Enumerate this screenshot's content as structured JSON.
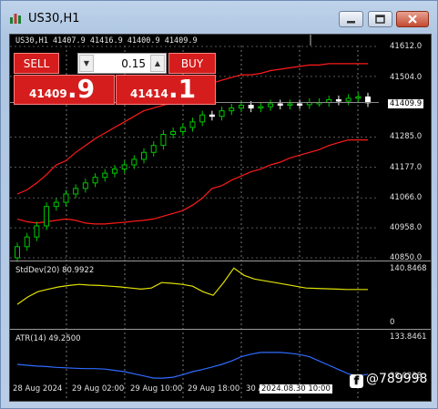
{
  "window": {
    "title": "US30,H1",
    "icon": "chart-bars-icon",
    "controls": [
      "minimize-icon",
      "restore-icon",
      "close-icon"
    ]
  },
  "chart": {
    "header": "US30,H1  41407.9 41416.9 41400.9 41409.9",
    "current_price": "41409.9",
    "price_axis": [
      "41612.0",
      "41504.0",
      "41285.0",
      "41177.0",
      "41066.0",
      "40958.0",
      "40850.0"
    ],
    "time_axis": [
      "28 Aug 2024",
      "29 Aug 02:00",
      "29 Aug 10:00",
      "29 Aug 18:00",
      "30 Au"
    ],
    "crosshair_time": "2024.08.30 10:00",
    "stddev": {
      "label": "StdDev(20) 80.9922",
      "max": "140.8468",
      "min": "0"
    },
    "atr": {
      "label": "ATR(14) 49.2500",
      "max": "133.8461",
      "min": "38.0238"
    },
    "colors": {
      "bull": "#00c800",
      "bear": "#ffffff",
      "band": "#ff1a1a",
      "stddev": "#e0e000",
      "atr": "#2f6bff"
    }
  },
  "trade_panel": {
    "sell_label": "SELL",
    "buy_label": "BUY",
    "volume": "0.15",
    "sell_price_main": "41409",
    "sell_price_frac": ".9",
    "buy_price_main": "41414",
    "buy_price_frac": ".1"
  },
  "watermark": {
    "icon": "facebook-icon",
    "text": "@789998"
  },
  "chart_data": {
    "type": "line",
    "title": "US30,H1",
    "candles_close": [
      40890,
      40925,
      40965,
      41035,
      41050,
      41080,
      41100,
      41120,
      41140,
      41155,
      41170,
      41185,
      41205,
      41230,
      41255,
      41295,
      41305,
      41320,
      41340,
      41365,
      41360,
      41380,
      41390,
      41400,
      41390,
      41395,
      41405,
      41400,
      41405,
      41402,
      41410,
      41410,
      41420,
      41415,
      41425,
      41430,
      41409
    ],
    "upper_band": [
      41080,
      41095,
      41120,
      41150,
      41185,
      41200,
      41230,
      41255,
      41280,
      41300,
      41320,
      41340,
      41360,
      41380,
      41390,
      41400,
      41410,
      41420,
      41440,
      41460,
      41480,
      41490,
      41500,
      41510,
      41510,
      41515,
      41525,
      41530,
      41535,
      41540,
      41545,
      41545,
      41550,
      41550,
      41550,
      41550,
      41550
    ],
    "lower_band": [
      40990,
      40980,
      40975,
      40980,
      40985,
      40990,
      40985,
      40975,
      40972,
      40972,
      40975,
      40978,
      40982,
      40985,
      40990,
      41000,
      41010,
      41020,
      41040,
      41065,
      41100,
      41110,
      41130,
      41145,
      41160,
      41170,
      41185,
      41195,
      41210,
      41220,
      41230,
      41240,
      41255,
      41265,
      41275,
      41275,
      41275
    ],
    "stddev": [
      40,
      60,
      75,
      82,
      88,
      92,
      95,
      93,
      92,
      90,
      88,
      85,
      82,
      85,
      100,
      98,
      95,
      90,
      75,
      65,
      100,
      140,
      120,
      110,
      105,
      100,
      95,
      90,
      85,
      84,
      83,
      82,
      81,
      81,
      81
    ],
    "atr": [
      72,
      70,
      68,
      67,
      65,
      64,
      63,
      62,
      62,
      61,
      58,
      55,
      50,
      45,
      40,
      40,
      42,
      48,
      55,
      60,
      66,
      72,
      80,
      90,
      96,
      100,
      100,
      100,
      98,
      95,
      90,
      80,
      70,
      60,
      50,
      45,
      49
    ],
    "ylim": [
      40850,
      41612
    ]
  }
}
